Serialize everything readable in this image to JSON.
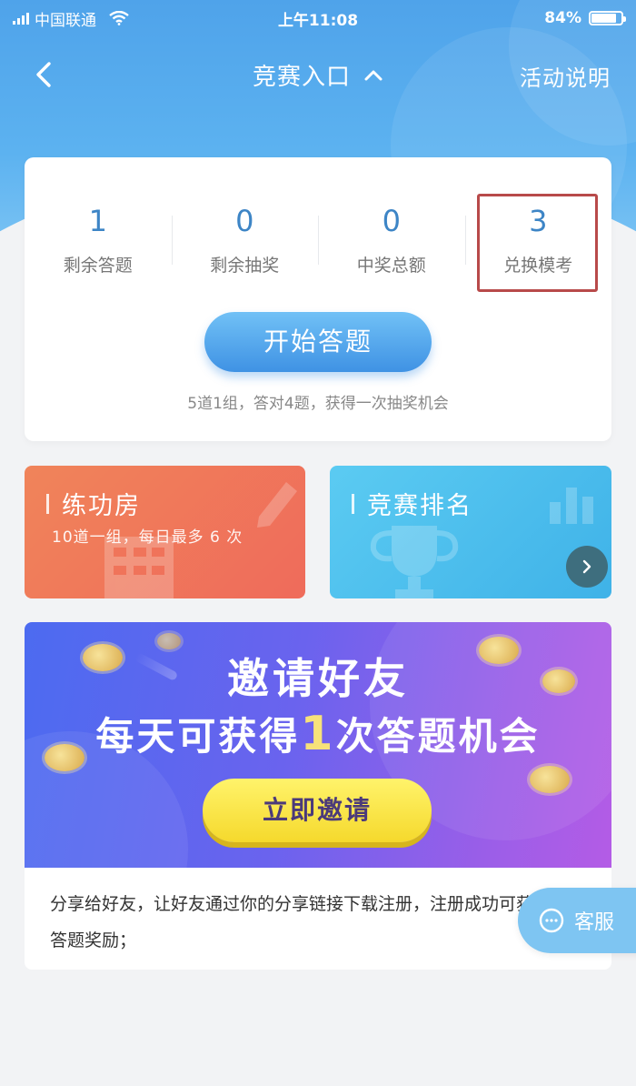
{
  "status_bar": {
    "carrier": "中国联通",
    "time": "上午11:08",
    "battery_percent_label": "84%",
    "battery_level": 0.84
  },
  "nav": {
    "title": "竞赛入口",
    "rules_label": "活动说明"
  },
  "stats": [
    {
      "value": "1",
      "label": "剩余答题"
    },
    {
      "value": "0",
      "label": "剩余抽奖"
    },
    {
      "value": "0",
      "label": "中奖总额"
    },
    {
      "value": "3",
      "label": "兑换模考"
    }
  ],
  "start_button_label": "开始答题",
  "rule_note": "5道1组，答对4题，获得一次抽奖机会",
  "features": {
    "practice": {
      "title": "练功房",
      "subtitle": "10道一组，每日最多 6 次"
    },
    "ranking": {
      "title": "竞赛排名"
    }
  },
  "invite": {
    "title": "邀请好友",
    "subtitle_prefix": "每天可获得",
    "subtitle_number": "1",
    "subtitle_suffix": "次答题机会",
    "button_label": "立即邀请",
    "description": "分享给好友，让好友通过你的分享链接下载注册，注册成功可获得1次答题奖励；"
  },
  "service_label": "客服",
  "colors": {
    "header_blue": "#4fa3ea",
    "stat_value": "#3d85c6",
    "highlight_border": "#b84a4a",
    "practice_card": "#ef6b5b",
    "ranking_card": "#3fb2e8",
    "invite_button": "#f5d92c"
  },
  "icons": {
    "back": "chevron-left-icon",
    "title_toggle": "chevron-up-icon",
    "ranking_arrow": "chevron-right-icon",
    "service": "chat-bubble-icon"
  }
}
